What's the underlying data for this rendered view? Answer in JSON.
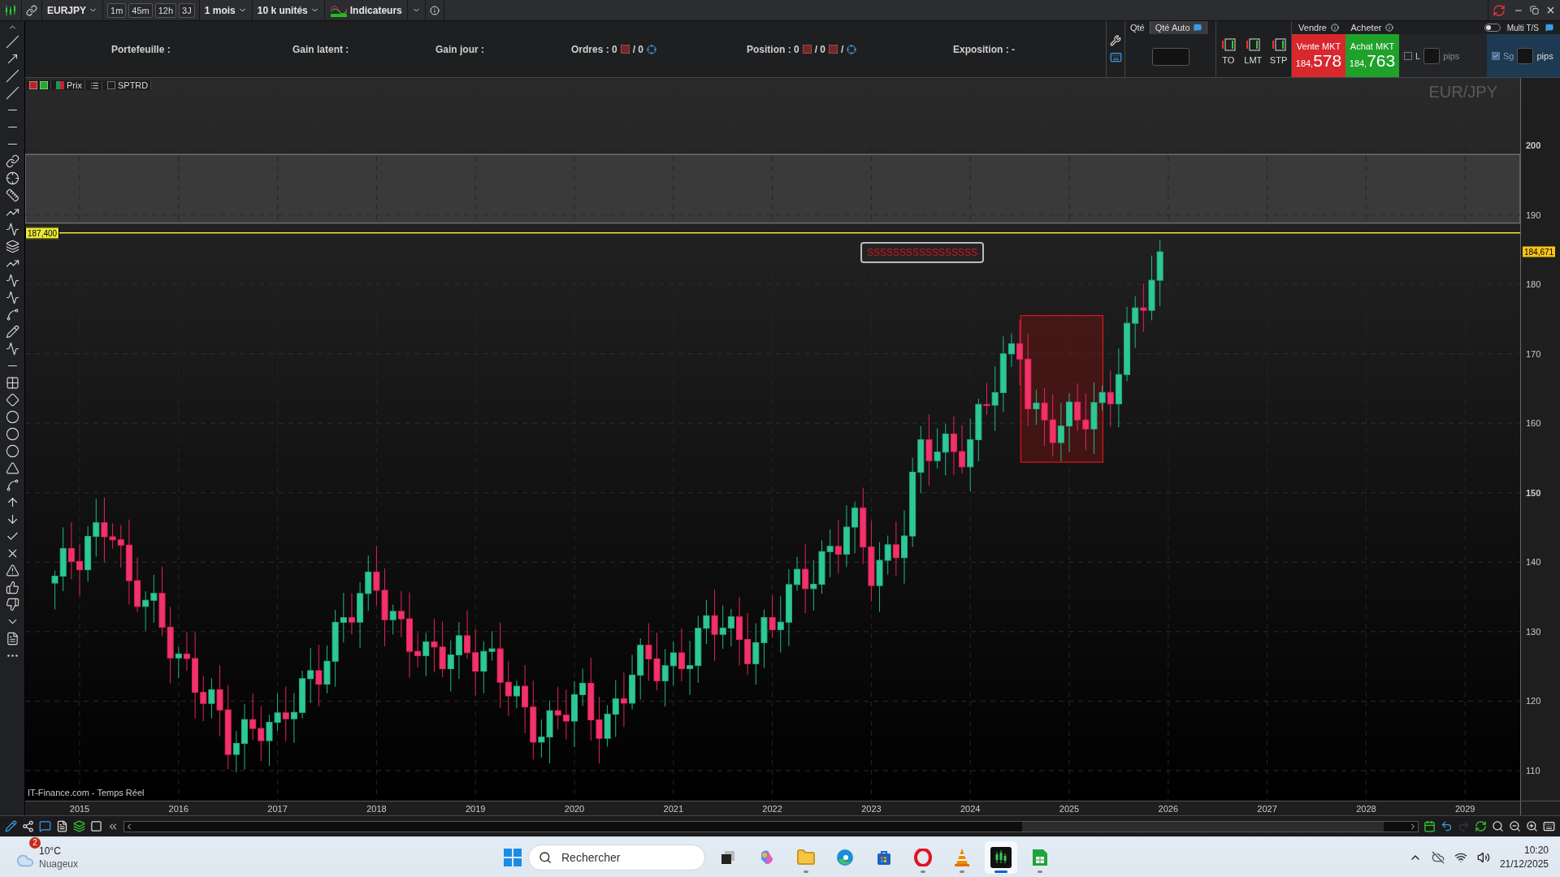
{
  "toolbar": {
    "symbol": "EURJPY",
    "timeframes": [
      {
        "label": "1m"
      },
      {
        "label": "45m"
      },
      {
        "label": "12h"
      },
      {
        "label": "3J"
      }
    ],
    "period": "1 mois",
    "quantity": "10 k unités",
    "indicators": "Indicateurs"
  },
  "info_bar": {
    "labels": [
      "Portefeuille :",
      "Gain latent :",
      "Gain jour :"
    ],
    "orders": {
      "label": "Ordres : 0",
      "second": "/ 0"
    },
    "position": {
      "label": "Position : 0",
      "second": "/ 0",
      "third": "/"
    },
    "exposure": "Exposition : -"
  },
  "quantity_panel": {
    "tabs": [
      {
        "label": "Qté",
        "selected": false
      },
      {
        "label": "Qté Auto",
        "selected": true
      }
    ]
  },
  "order_types": [
    "TO",
    "LMT",
    "STP"
  ],
  "trade": {
    "sell_header": "Vendre",
    "buy_header": "Acheter",
    "sell": {
      "label": "Vente MKT",
      "price_small": "184,",
      "price_big": "578"
    },
    "buy": {
      "label": "Achat MKT",
      "price_small": "184,",
      "price_big": "763"
    }
  },
  "risk": {
    "multi_ts": {
      "label": "Multi T/S",
      "on": false
    },
    "limit": {
      "label": "L",
      "checked": false,
      "unit": "pips"
    },
    "stop": {
      "label": "Sg",
      "checked": true,
      "unit": "pips"
    }
  },
  "chart": {
    "legend": {
      "price": "Prix",
      "study": "SPTRD",
      "study_checked": false
    },
    "watermark": "EUR/JPY",
    "price_axis": [
      {
        "label": "200",
        "major": true
      },
      {
        "label": "190",
        "major": false
      },
      {
        "label": "180",
        "major": false
      },
      {
        "label": "170",
        "major": false
      },
      {
        "label": "160",
        "major": false
      },
      {
        "label": "150",
        "major": true
      },
      {
        "label": "140",
        "major": false
      },
      {
        "label": "130",
        "major": false
      },
      {
        "label": "120",
        "major": false
      },
      {
        "label": "110",
        "major": false
      }
    ],
    "line_label": "187,400",
    "current_price": "184,671",
    "annotation": "SSSSSSSSSSSSSSSSS",
    "source": "IT-Finance.com - Temps Réel",
    "years": [
      "2015",
      "2016",
      "2017",
      "2018",
      "2019",
      "2020",
      "2021",
      "2022",
      "2023",
      "2024",
      "2025",
      "2026",
      "2027",
      "2028",
      "2029"
    ]
  },
  "taskbar": {
    "weather": {
      "badge": "2",
      "temperature": "10°C",
      "condition": "Nuageux"
    },
    "search": {
      "placeholder": "Rechercher"
    },
    "apps": [
      {
        "kind": "taskview",
        "running": false,
        "selected": false
      },
      {
        "kind": "copilot",
        "running": false,
        "selected": false
      },
      {
        "kind": "folder",
        "running": true,
        "selected": false
      },
      {
        "kind": "edge",
        "running": false,
        "selected": false
      },
      {
        "kind": "store",
        "running": false,
        "selected": false
      },
      {
        "kind": "opera",
        "running": true,
        "selected": false
      },
      {
        "kind": "vlc",
        "running": true,
        "selected": false
      },
      {
        "kind": "trading",
        "running": true,
        "selected": true
      },
      {
        "kind": "sheet",
        "running": true,
        "selected": false
      }
    ],
    "time": "10:20",
    "date": "21/12/2025"
  }
}
